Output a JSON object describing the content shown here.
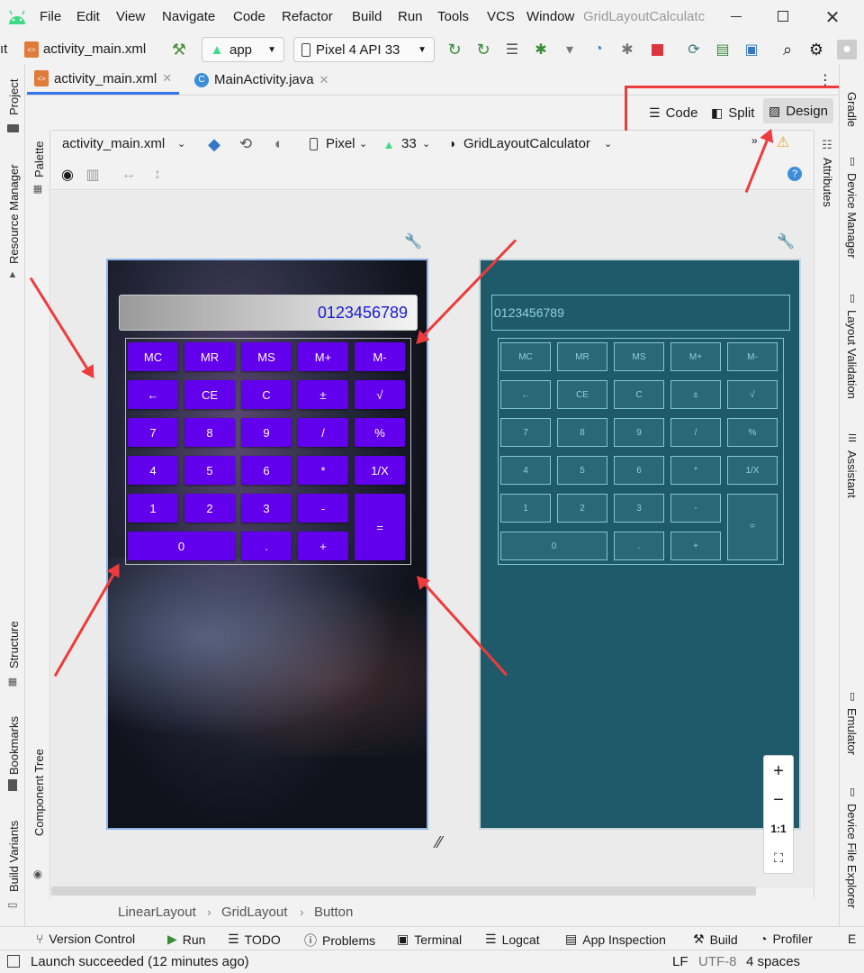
{
  "menu": [
    "File",
    "Edit",
    "View",
    "Navigate",
    "Code",
    "Refactor",
    "Build",
    "Run",
    "Tools",
    "VCS",
    "Window"
  ],
  "window_title": "GridLayoutCalculatc",
  "toolbar": {
    "breadcrumb_file": "activity_main.xml",
    "run_config": "app",
    "device": "Pixel 4 API 33"
  },
  "editor_tabs": [
    {
      "label": "activity_main.xml"
    },
    {
      "label": "MainActivity.java"
    }
  ],
  "view_modes": {
    "code": "Code",
    "split": "Split",
    "design": "Design"
  },
  "design_toolbar": {
    "file": "activity_main.xml",
    "device": "Pixel",
    "api": "33",
    "theme": "GridLayoutCalculator"
  },
  "left_tools": {
    "project": "Project",
    "resource_manager": "Resource Manager",
    "structure": "Structure",
    "bookmarks": "Bookmarks",
    "build_variants": "Build Variants"
  },
  "palette_tools": {
    "palette": "Palette",
    "component_tree": "Component Tree"
  },
  "right_tools": {
    "gradle": "Gradle",
    "device_manager": "Device Manager",
    "layout_validation": "Layout Validation",
    "assistant": "Assistant",
    "emulator": "Emulator",
    "device_file_explorer": "Device File Explorer"
  },
  "attributes_label": "Attributes",
  "calculator": {
    "display": "0123456789",
    "rows": [
      [
        "MC",
        "MR",
        "MS",
        "M+",
        "M-"
      ],
      [
        "←",
        "CE",
        "C",
        "±",
        "√"
      ],
      [
        "7",
        "8",
        "9",
        "/",
        "%"
      ],
      [
        "4",
        "5",
        "6",
        "*",
        "1/X"
      ],
      [
        "1",
        "2",
        "3",
        "-",
        ""
      ],
      [
        "0",
        ".",
        "+",
        "="
      ]
    ],
    "accent": "#6200ee"
  },
  "blueprint_display": "0123456789",
  "zoom": {
    "fit": "1:1"
  },
  "breadcrumb": [
    "LinearLayout",
    "GridLayout",
    "Button"
  ],
  "tool_windows": [
    "Version Control",
    "Run",
    "TODO",
    "Problems",
    "Terminal",
    "Logcat",
    "App Inspection",
    "Build",
    "Profiler"
  ],
  "status": {
    "message": "Launch succeeded (12 minutes ago)",
    "line_sep": "LF",
    "encoding": "UTF-8",
    "indent": "4 spaces"
  }
}
